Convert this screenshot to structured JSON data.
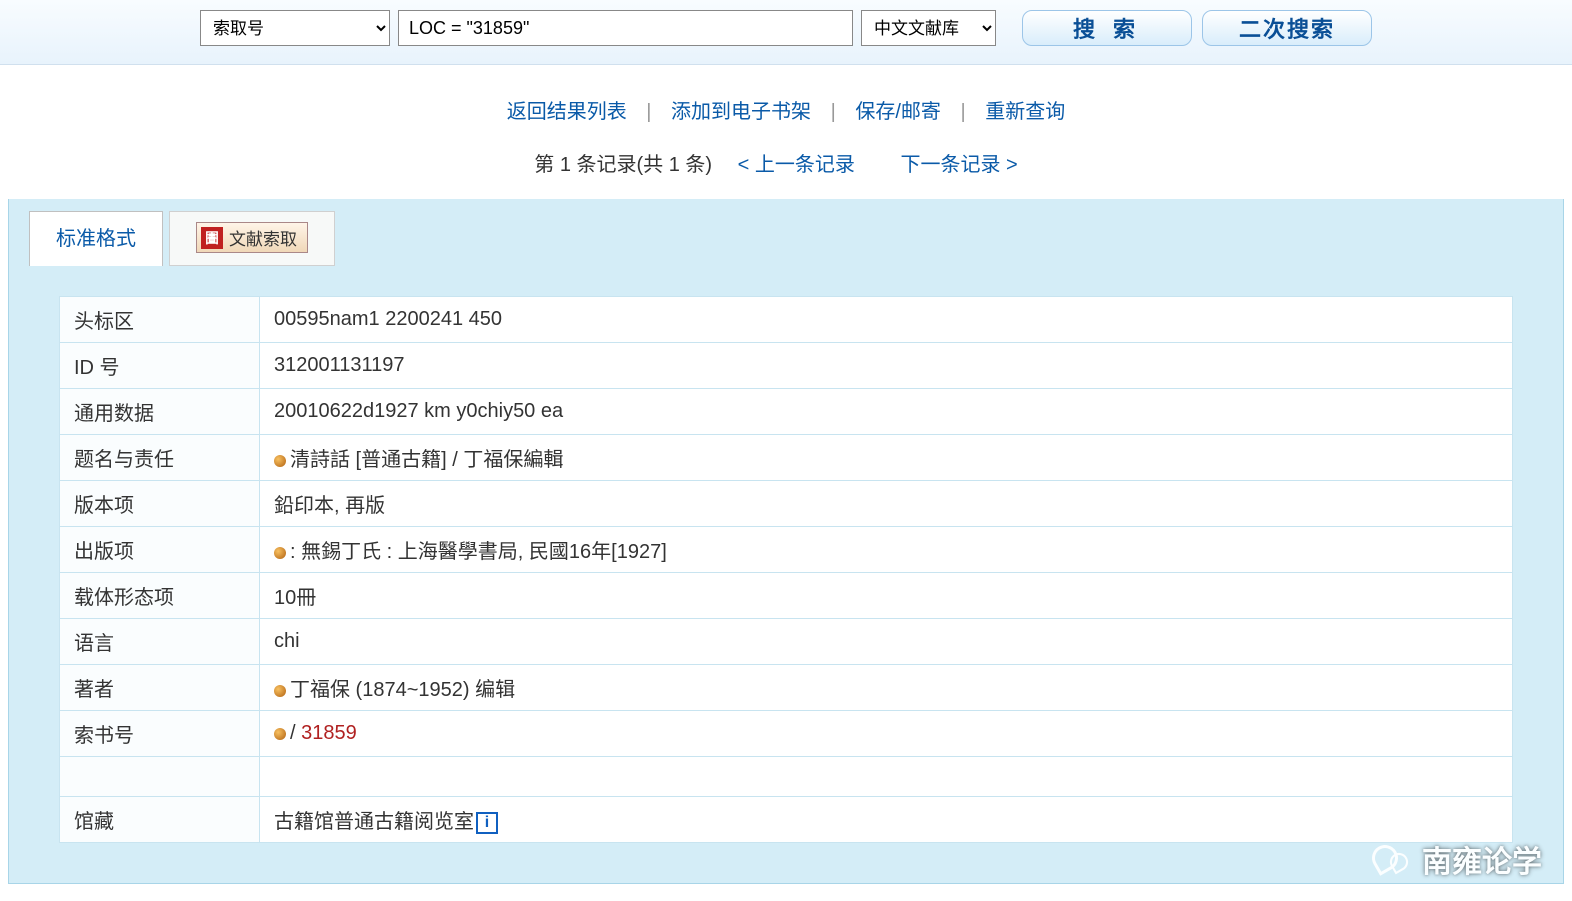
{
  "searchBar": {
    "fieldSelect": "索取号",
    "query": "LOC = \"31859\"",
    "dbSelect": "中文文献库",
    "searchBtn": "搜 索",
    "reSearchBtn": "二次搜索"
  },
  "navLinks": {
    "backList": "返回结果列表",
    "addShelf": "添加到电子书架",
    "saveMail": "保存/邮寄",
    "reQuery": "重新查询"
  },
  "recordNav": {
    "position": "第 1 条记录(共 1 条)",
    "prev": "< 上一条记录",
    "next": "下一条记录 >"
  },
  "tabs": {
    "standard": "标准格式",
    "docRequest": "文献索取"
  },
  "record": {
    "rows": [
      {
        "label": "头标区",
        "value": "00595nam1 2200241 450",
        "bullet": false
      },
      {
        "label": "ID 号",
        "value": "312001131197",
        "bullet": false
      },
      {
        "label": "通用数据",
        "value": "20010622d1927 km y0chiy50 ea",
        "bullet": false
      },
      {
        "label": "题名与责任",
        "value": "清詩話 [普通古籍] / 丁福保編輯",
        "bullet": true
      },
      {
        "label": "版本项",
        "value": "鉛印本, 再版",
        "bullet": false
      },
      {
        "label": "出版项",
        "value": ": 無錫丁氏 : 上海醫學書局, 民國16年[1927]",
        "bullet": true
      },
      {
        "label": "载体形态项",
        "value": "10冊",
        "bullet": false
      },
      {
        "label": "语言",
        "value": "chi",
        "bullet": false
      },
      {
        "label": "著者",
        "value": "丁福保 (1874~1952) 编辑",
        "bullet": true
      }
    ],
    "callNumber": {
      "label": "索书号",
      "slash": "/ ",
      "value": "31859"
    },
    "holdings": {
      "label": "馆藏",
      "value": "古籍馆普通古籍阅览室"
    }
  },
  "watermark": "南雍论学"
}
